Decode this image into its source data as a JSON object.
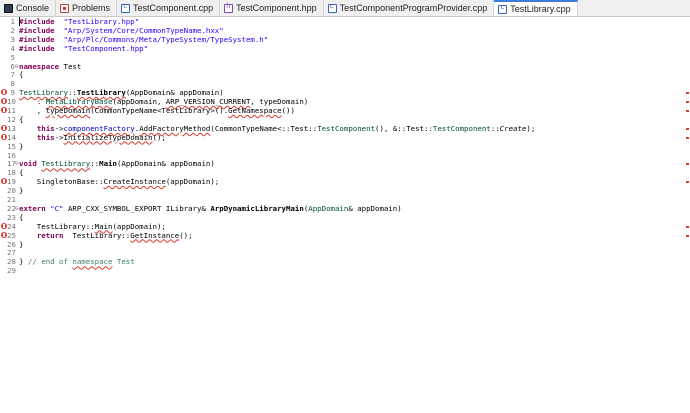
{
  "tabs": [
    {
      "label": "Console",
      "icon": "console-icon",
      "active": false
    },
    {
      "label": "Problems",
      "icon": "problems-icon",
      "active": false
    },
    {
      "label": "TestComponent.cpp",
      "icon": "cpp-file-icon",
      "active": false
    },
    {
      "label": "TestComponent.hpp",
      "icon": "hpp-file-icon",
      "active": false
    },
    {
      "label": "TestComponentProgramProvider.cpp",
      "icon": "cpp-file-icon",
      "active": false
    },
    {
      "label": "TestLibrary.cpp",
      "icon": "cpp-file-icon",
      "active": true
    }
  ],
  "lines": [
    {
      "n": "1",
      "fold": "",
      "err": false,
      "mark": false,
      "parts": [
        [
          "kw",
          "#include"
        ],
        [
          "",
          "  "
        ],
        [
          "str",
          "\"TestLibrary.hpp\""
        ]
      ]
    },
    {
      "n": "2",
      "fold": "",
      "err": false,
      "mark": false,
      "parts": [
        [
          "kw",
          "#include"
        ],
        [
          "",
          "  "
        ],
        [
          "str",
          "\"Arp/System/Core/CommonTypeName.hxx\""
        ]
      ]
    },
    {
      "n": "3",
      "fold": "",
      "err": false,
      "mark": false,
      "parts": [
        [
          "kw",
          "#include"
        ],
        [
          "",
          "  "
        ],
        [
          "str",
          "\"Arp/Plc/Commons/Meta/TypeSystem/TypeSystem.h\""
        ]
      ]
    },
    {
      "n": "4",
      "fold": "",
      "err": false,
      "mark": false,
      "parts": [
        [
          "kw",
          "#include"
        ],
        [
          "",
          "  "
        ],
        [
          "str",
          "\"TestComponent.hpp\""
        ]
      ]
    },
    {
      "n": "5",
      "fold": "",
      "err": false,
      "mark": false,
      "parts": []
    },
    {
      "n": "6",
      "fold": "⊖",
      "err": false,
      "mark": false,
      "parts": [
        [
          "kw",
          "namespace"
        ],
        [
          "",
          " Test"
        ]
      ]
    },
    {
      "n": "7",
      "fold": "",
      "err": false,
      "mark": false,
      "parts": [
        [
          "",
          "{"
        ]
      ]
    },
    {
      "n": "8",
      "fold": "",
      "err": false,
      "mark": false,
      "parts": []
    },
    {
      "n": "9",
      "fold": "",
      "err": true,
      "mark": true,
      "parts": [
        [
          "cls sq",
          "TestLibrary"
        ],
        [
          "",
          "::"
        ],
        [
          "fn sq",
          "TestLibrary"
        ],
        [
          "",
          "(AppDomain& appDomain)"
        ]
      ]
    },
    {
      "n": "10",
      "fold": "",
      "err": true,
      "mark": true,
      "parts": [
        [
          "",
          "    : "
        ],
        [
          "cls sq",
          "MetaLibraryBase"
        ],
        [
          "",
          "(appDomain, "
        ],
        [
          "sq",
          "ARP_VERSION_CURRENT"
        ],
        [
          "",
          ", typeDomain)"
        ]
      ]
    },
    {
      "n": "11",
      "fold": "",
      "err": true,
      "mark": true,
      "parts": [
        [
          "",
          "    , "
        ],
        [
          "sq",
          "typeDomain"
        ],
        [
          "",
          "(CommonTypeName<TestLibrary>()."
        ],
        [
          "sq",
          "GetNamespace"
        ],
        [
          "",
          "())"
        ]
      ]
    },
    {
      "n": "12",
      "fold": "",
      "err": false,
      "mark": false,
      "parts": [
        [
          "",
          "{"
        ]
      ]
    },
    {
      "n": "13",
      "fold": "",
      "err": true,
      "mark": true,
      "parts": [
        [
          "",
          "    "
        ],
        [
          "kw",
          "this"
        ],
        [
          "",
          "->"
        ],
        [
          "mem sq",
          "componentFactory"
        ],
        [
          "",
          "."
        ],
        [
          "sq",
          "AddFactoryMethod"
        ],
        [
          "",
          "(CommonTypeName<::Test::"
        ],
        [
          "cls",
          "TestComponent"
        ],
        [
          "",
          "(), &::Test::"
        ],
        [
          "cls",
          "TestComponent"
        ],
        [
          "",
          "::"
        ],
        [
          "it",
          "Create"
        ],
        [
          "",
          ");"
        ]
      ]
    },
    {
      "n": "14",
      "fold": "",
      "err": true,
      "mark": true,
      "parts": [
        [
          "",
          "    "
        ],
        [
          "kw",
          "this"
        ],
        [
          "",
          "->"
        ],
        [
          "sq",
          "InitializeTypeDomain"
        ],
        [
          "",
          "();"
        ]
      ]
    },
    {
      "n": "15",
      "fold": "",
      "err": false,
      "mark": false,
      "parts": [
        [
          "",
          "}"
        ]
      ]
    },
    {
      "n": "16",
      "fold": "",
      "err": false,
      "mark": false,
      "parts": []
    },
    {
      "n": "17",
      "fold": "⊖",
      "err": false,
      "mark": true,
      "parts": [
        [
          "kw",
          "void"
        ],
        [
          "",
          " "
        ],
        [
          "cls sq",
          "TestLibrary"
        ],
        [
          "",
          "::"
        ],
        [
          "fn",
          "Main"
        ],
        [
          "",
          "(AppDomain& appDomain)"
        ]
      ]
    },
    {
      "n": "18",
      "fold": "",
      "err": false,
      "mark": false,
      "parts": [
        [
          "",
          "{"
        ]
      ]
    },
    {
      "n": "19",
      "fold": "",
      "err": true,
      "mark": true,
      "parts": [
        [
          "",
          "    SingletonBase::"
        ],
        [
          "sq",
          "CreateInstance"
        ],
        [
          "",
          "(appDomain);"
        ]
      ]
    },
    {
      "n": "20",
      "fold": "",
      "err": false,
      "mark": false,
      "parts": [
        [
          "",
          "}"
        ]
      ]
    },
    {
      "n": "21",
      "fold": "",
      "err": false,
      "mark": false,
      "parts": []
    },
    {
      "n": "22",
      "fold": "⊖",
      "err": false,
      "mark": false,
      "parts": [
        [
          "kw",
          "extern"
        ],
        [
          "",
          " "
        ],
        [
          "str",
          "\"C\""
        ],
        [
          "",
          " ARP_CXX_SYMBOL_EXPORT ILibrary& "
        ],
        [
          "fn",
          "ArpDynamicLibraryMain"
        ],
        [
          "",
          "("
        ],
        [
          "cls",
          "AppDomain"
        ],
        [
          "",
          "& appDomain)"
        ]
      ]
    },
    {
      "n": "23",
      "fold": "",
      "err": false,
      "mark": false,
      "parts": [
        [
          "",
          "{"
        ]
      ]
    },
    {
      "n": "24",
      "fold": "",
      "err": true,
      "mark": true,
      "parts": [
        [
          "",
          "    TestLibrary::"
        ],
        [
          "sq",
          "Main"
        ],
        [
          "",
          "(appDomain);"
        ]
      ]
    },
    {
      "n": "25",
      "fold": "",
      "err": true,
      "mark": true,
      "parts": [
        [
          "",
          "    "
        ],
        [
          "kw",
          "return"
        ],
        [
          "",
          "  TestLibrary::"
        ],
        [
          "sq",
          "GetInstance"
        ],
        [
          "",
          "();"
        ]
      ]
    },
    {
      "n": "26",
      "fold": "",
      "err": false,
      "mark": false,
      "parts": [
        [
          "",
          "}"
        ]
      ]
    },
    {
      "n": "27",
      "fold": "",
      "err": false,
      "mark": false,
      "parts": []
    },
    {
      "n": "28",
      "fold": "",
      "err": false,
      "mark": false,
      "parts": [
        [
          "",
          "} "
        ],
        [
          "cmt",
          "// end of "
        ],
        [
          "cmt sq",
          "namespace"
        ],
        [
          "cmt",
          " Test"
        ]
      ]
    },
    {
      "n": "29",
      "fold": "",
      "err": false,
      "mark": false,
      "parts": []
    }
  ]
}
